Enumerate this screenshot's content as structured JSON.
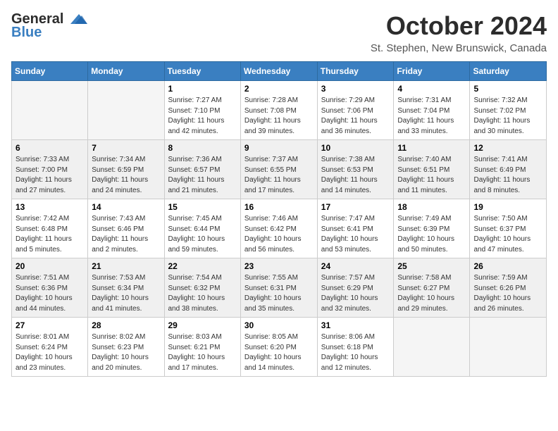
{
  "header": {
    "logo_general": "General",
    "logo_blue": "Blue",
    "month_title": "October 2024",
    "location": "St. Stephen, New Brunswick, Canada"
  },
  "weekdays": [
    "Sunday",
    "Monday",
    "Tuesday",
    "Wednesday",
    "Thursday",
    "Friday",
    "Saturday"
  ],
  "weeks": [
    [
      {
        "day": "",
        "empty": true
      },
      {
        "day": "",
        "empty": true
      },
      {
        "day": "1",
        "info": "Sunrise: 7:27 AM\nSunset: 7:10 PM\nDaylight: 11 hours and 42 minutes."
      },
      {
        "day": "2",
        "info": "Sunrise: 7:28 AM\nSunset: 7:08 PM\nDaylight: 11 hours and 39 minutes."
      },
      {
        "day": "3",
        "info": "Sunrise: 7:29 AM\nSunset: 7:06 PM\nDaylight: 11 hours and 36 minutes."
      },
      {
        "day": "4",
        "info": "Sunrise: 7:31 AM\nSunset: 7:04 PM\nDaylight: 11 hours and 33 minutes."
      },
      {
        "day": "5",
        "info": "Sunrise: 7:32 AM\nSunset: 7:02 PM\nDaylight: 11 hours and 30 minutes."
      }
    ],
    [
      {
        "day": "6",
        "info": "Sunrise: 7:33 AM\nSunset: 7:00 PM\nDaylight: 11 hours and 27 minutes."
      },
      {
        "day": "7",
        "info": "Sunrise: 7:34 AM\nSunset: 6:59 PM\nDaylight: 11 hours and 24 minutes."
      },
      {
        "day": "8",
        "info": "Sunrise: 7:36 AM\nSunset: 6:57 PM\nDaylight: 11 hours and 21 minutes."
      },
      {
        "day": "9",
        "info": "Sunrise: 7:37 AM\nSunset: 6:55 PM\nDaylight: 11 hours and 17 minutes."
      },
      {
        "day": "10",
        "info": "Sunrise: 7:38 AM\nSunset: 6:53 PM\nDaylight: 11 hours and 14 minutes."
      },
      {
        "day": "11",
        "info": "Sunrise: 7:40 AM\nSunset: 6:51 PM\nDaylight: 11 hours and 11 minutes."
      },
      {
        "day": "12",
        "info": "Sunrise: 7:41 AM\nSunset: 6:49 PM\nDaylight: 11 hours and 8 minutes."
      }
    ],
    [
      {
        "day": "13",
        "info": "Sunrise: 7:42 AM\nSunset: 6:48 PM\nDaylight: 11 hours and 5 minutes."
      },
      {
        "day": "14",
        "info": "Sunrise: 7:43 AM\nSunset: 6:46 PM\nDaylight: 11 hours and 2 minutes."
      },
      {
        "day": "15",
        "info": "Sunrise: 7:45 AM\nSunset: 6:44 PM\nDaylight: 10 hours and 59 minutes."
      },
      {
        "day": "16",
        "info": "Sunrise: 7:46 AM\nSunset: 6:42 PM\nDaylight: 10 hours and 56 minutes."
      },
      {
        "day": "17",
        "info": "Sunrise: 7:47 AM\nSunset: 6:41 PM\nDaylight: 10 hours and 53 minutes."
      },
      {
        "day": "18",
        "info": "Sunrise: 7:49 AM\nSunset: 6:39 PM\nDaylight: 10 hours and 50 minutes."
      },
      {
        "day": "19",
        "info": "Sunrise: 7:50 AM\nSunset: 6:37 PM\nDaylight: 10 hours and 47 minutes."
      }
    ],
    [
      {
        "day": "20",
        "info": "Sunrise: 7:51 AM\nSunset: 6:36 PM\nDaylight: 10 hours and 44 minutes."
      },
      {
        "day": "21",
        "info": "Sunrise: 7:53 AM\nSunset: 6:34 PM\nDaylight: 10 hours and 41 minutes."
      },
      {
        "day": "22",
        "info": "Sunrise: 7:54 AM\nSunset: 6:32 PM\nDaylight: 10 hours and 38 minutes."
      },
      {
        "day": "23",
        "info": "Sunrise: 7:55 AM\nSunset: 6:31 PM\nDaylight: 10 hours and 35 minutes."
      },
      {
        "day": "24",
        "info": "Sunrise: 7:57 AM\nSunset: 6:29 PM\nDaylight: 10 hours and 32 minutes."
      },
      {
        "day": "25",
        "info": "Sunrise: 7:58 AM\nSunset: 6:27 PM\nDaylight: 10 hours and 29 minutes."
      },
      {
        "day": "26",
        "info": "Sunrise: 7:59 AM\nSunset: 6:26 PM\nDaylight: 10 hours and 26 minutes."
      }
    ],
    [
      {
        "day": "27",
        "info": "Sunrise: 8:01 AM\nSunset: 6:24 PM\nDaylight: 10 hours and 23 minutes."
      },
      {
        "day": "28",
        "info": "Sunrise: 8:02 AM\nSunset: 6:23 PM\nDaylight: 10 hours and 20 minutes."
      },
      {
        "day": "29",
        "info": "Sunrise: 8:03 AM\nSunset: 6:21 PM\nDaylight: 10 hours and 17 minutes."
      },
      {
        "day": "30",
        "info": "Sunrise: 8:05 AM\nSunset: 6:20 PM\nDaylight: 10 hours and 14 minutes."
      },
      {
        "day": "31",
        "info": "Sunrise: 8:06 AM\nSunset: 6:18 PM\nDaylight: 10 hours and 12 minutes."
      },
      {
        "day": "",
        "empty": true
      },
      {
        "day": "",
        "empty": true
      }
    ]
  ]
}
